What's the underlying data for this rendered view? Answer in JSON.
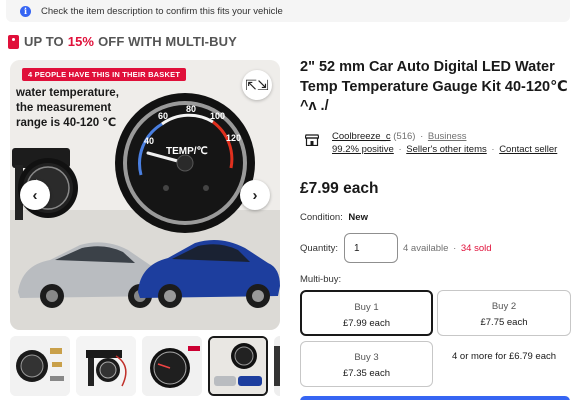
{
  "info_bar": {
    "text": "Check the item description to confirm this fits your vehicle"
  },
  "promo": {
    "prefix": "UP TO",
    "percent": "15%",
    "suffix": "OFF WITH MULTI-BUY"
  },
  "gallery": {
    "banner": "4 PEOPLE HAVE THIS IN THEIR BASKET",
    "caption_lines": [
      "water temperature,",
      "the measurement",
      "range is 40-120 ℃"
    ],
    "gauge": {
      "unit_label": "TEMP/℃",
      "ticks": [
        "40",
        "60",
        "80",
        "100",
        "120"
      ]
    },
    "thumbnail_count": 5,
    "selected_thumbnail": 4
  },
  "listing": {
    "title": "2\" 52 mm Car Auto Digital LED Water Temp Temperature Gauge Kit 40-120℃ ^ʌ ./"
  },
  "seller": {
    "name": "Coolbreeze_c",
    "feedback_count": "(516)",
    "type": "Business",
    "positive": "99.2% positive",
    "other_items": "Seller's other items",
    "contact": "Contact seller"
  },
  "price": {
    "text": "£7.99 each"
  },
  "condition": {
    "label": "Condition:",
    "value": "New"
  },
  "quantity": {
    "label": "Quantity:",
    "value": "1",
    "available": "4 available",
    "sold": "34 sold"
  },
  "multibuy": {
    "label": "Multi-buy:",
    "options": [
      {
        "title": "Buy 1",
        "price": "£7.99 each"
      },
      {
        "title": "Buy 2",
        "price": "£7.75 each"
      },
      {
        "title": "Buy 3",
        "price": "£7.35 each"
      }
    ],
    "more": "4 or more for £6.79 each"
  },
  "colors": {
    "accent": "#3665f3",
    "sale_red": "#e0103a",
    "text": "#191919",
    "muted": "#707070"
  },
  "icons": {
    "info": "info-icon",
    "tag": "tag-icon",
    "expand": "expand-icon",
    "prev": "chevron-left-icon",
    "next": "chevron-right-icon",
    "store": "store-icon"
  }
}
